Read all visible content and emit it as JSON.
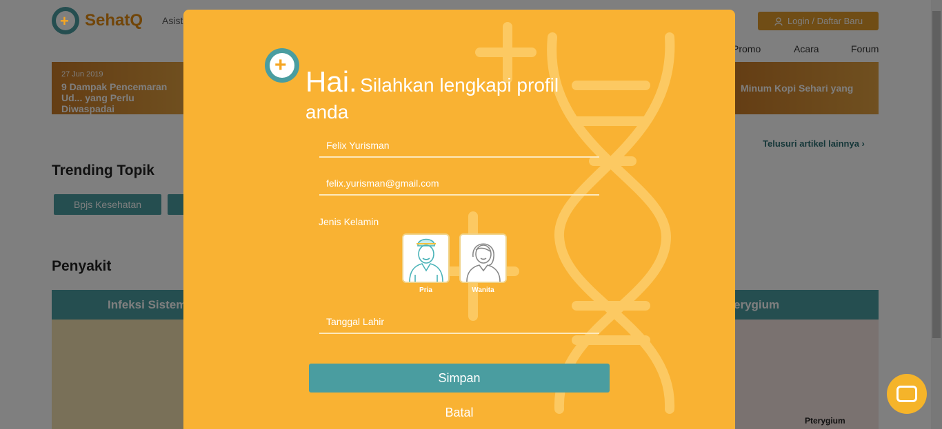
{
  "brand": {
    "name": "SehatQ",
    "assist_text": "Asist",
    "accent": "#f9b233",
    "teal": "#4a9da0"
  },
  "header": {
    "login_label": "Login / Daftar Baru",
    "nav": [
      "Promo",
      "Acara",
      "Forum"
    ]
  },
  "articles": [
    {
      "date": "27 Jun 2019",
      "title": "9 Dampak Pencemaran Ud... yang Perlu Diwaspadai"
    },
    {
      "title": "Minum Kopi Sehari yang"
    }
  ],
  "more_link": "Telusuri artikel lainnya",
  "trending": {
    "title": "Trending Topik",
    "tags": [
      "Bpjs Kesehatan"
    ]
  },
  "penyakit": {
    "title": "Penyakit",
    "cards": [
      "Infeksi Sistem",
      "erygium"
    ],
    "image_label": "Pterygium"
  },
  "modal": {
    "greeting_big": "Hai.",
    "greeting_rest": "Silahkan lengkapi profil anda",
    "name_value": "Felix Yurisman",
    "email_value": "felix.yurisman@gmail.com",
    "gender_label": "Jenis Kelamin",
    "gender_options": [
      "Pria",
      "Wanita"
    ],
    "gender_selected": "Pria",
    "dob_placeholder": "Tanggal Lahir",
    "submit_label": "Simpan",
    "cancel_label": "Batal"
  }
}
